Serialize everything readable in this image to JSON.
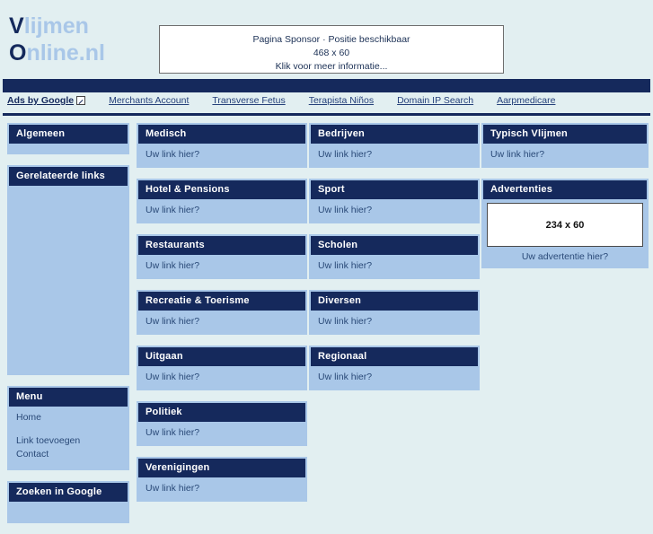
{
  "site": {
    "logo_line1_cap": "V",
    "logo_line1_rest": "lijmen",
    "logo_line2_cap": "O",
    "logo_line2_rest": "nline.nl"
  },
  "sponsor": {
    "line1": "Pagina Sponsor · Positie beschikbaar",
    "line2": "468 x 60",
    "line3": "Klik voor meer informatie..."
  },
  "google_ads": {
    "tag": "Ads by Google",
    "links": [
      "Merchants Account",
      "Transverse Fetus",
      "Terapista Niños",
      "Domain IP Search",
      "Aarpmedicare"
    ]
  },
  "sidebar": {
    "algemeen": {
      "title": "Algemeen"
    },
    "gerelateerde": {
      "title": "Gerelateerde links"
    },
    "menu": {
      "title": "Menu",
      "items": [
        "Home",
        "Link toevoegen",
        "Contact"
      ]
    },
    "zoeken": {
      "title": "Zoeken in Google"
    }
  },
  "link_placeholder": "Uw link hier?",
  "columns": {
    "col1": [
      {
        "title": "Medisch",
        "link": "Uw link hier?"
      },
      {
        "title": "Hotel & Pensions",
        "link": "Uw link hier?"
      },
      {
        "title": "Restaurants",
        "link": "Uw link hier?"
      },
      {
        "title": "Recreatie & Toerisme",
        "link": "Uw link hier?"
      },
      {
        "title": "Uitgaan",
        "link": "Uw link hier?"
      },
      {
        "title": "Politiek",
        "link": "Uw link hier?"
      },
      {
        "title": "Verenigingen",
        "link": "Uw link hier?"
      }
    ],
    "col2": [
      {
        "title": "Bedrijven",
        "link": "Uw link hier?"
      },
      {
        "title": "Sport",
        "link": "Uw link hier?"
      },
      {
        "title": "Scholen",
        "link": "Uw link hier?"
      },
      {
        "title": "Diversen",
        "link": "Uw link hier?"
      },
      {
        "title": "Regionaal",
        "link": "Uw link hier?"
      }
    ],
    "col3": [
      {
        "title": "Typisch Vlijmen",
        "link": "Uw link hier?"
      }
    ]
  },
  "advertenties": {
    "title": "Advertenties",
    "size": "234 x 60",
    "caption": "Uw advertentie hier?"
  },
  "colors": {
    "page_background": "#e2eff1",
    "navy": "#15295c",
    "card_frame": "#a9c7e8",
    "logo_light": "#a9c7e8",
    "link": "#2a4a78"
  }
}
